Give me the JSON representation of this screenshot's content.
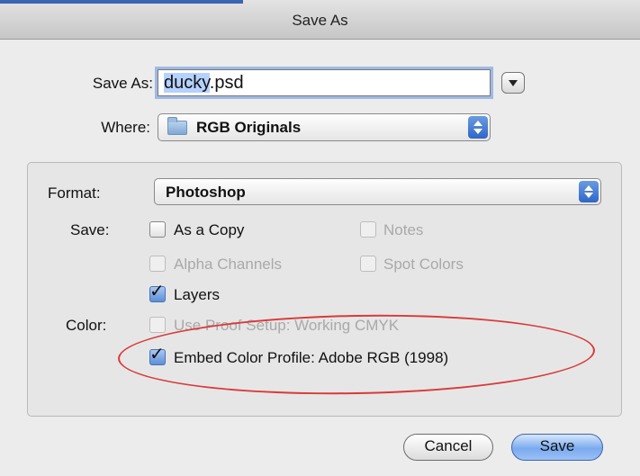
{
  "window": {
    "title": "Save As"
  },
  "save_as": {
    "label": "Save As:",
    "filename_selected": "ducky",
    "filename_ext": ".psd"
  },
  "where": {
    "label": "Where:",
    "value": "RGB Originals"
  },
  "format": {
    "label": "Format:",
    "value": "Photoshop"
  },
  "save_options": {
    "label": "Save:",
    "as_a_copy": {
      "label": "As a Copy",
      "checked": false,
      "enabled": true
    },
    "notes": {
      "label": "Notes",
      "checked": false,
      "enabled": false
    },
    "alpha_channels": {
      "label": "Alpha Channels",
      "checked": false,
      "enabled": false
    },
    "spot_colors": {
      "label": "Spot Colors",
      "checked": false,
      "enabled": false
    },
    "layers": {
      "label": "Layers",
      "checked": true,
      "enabled": true
    }
  },
  "color_options": {
    "label": "Color:",
    "use_proof_setup": {
      "label": "Use Proof Setup:  Working CMYK",
      "checked": false,
      "enabled": false
    },
    "embed_color_profile": {
      "label": "Embed Color Profile:  Adobe RGB (1998)",
      "checked": true,
      "enabled": true
    }
  },
  "buttons": {
    "cancel": "Cancel",
    "save": "Save"
  },
  "colors": {
    "highlight_oval": "#d93a3a",
    "accent": "#3b64b3"
  }
}
